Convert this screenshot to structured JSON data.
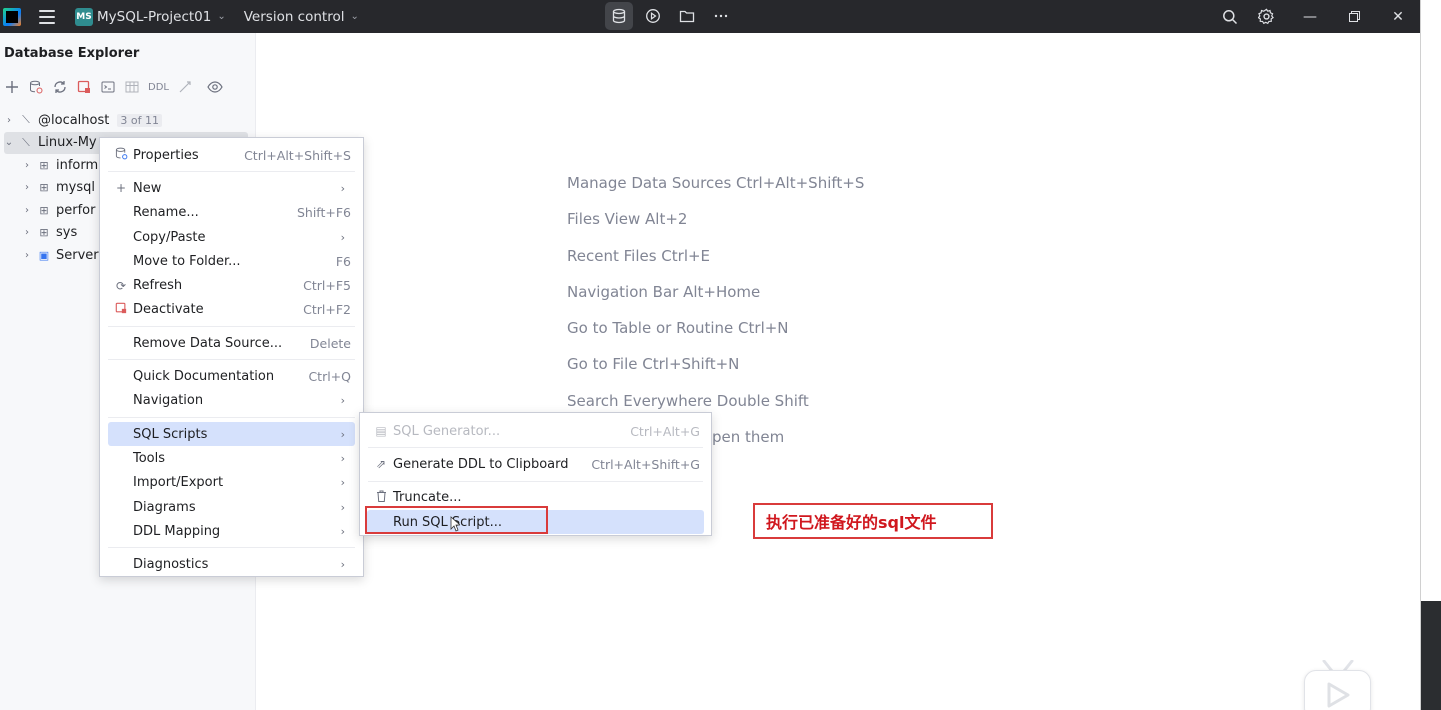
{
  "titlebar": {
    "project_badge": "MS",
    "project_name": "MySQL-Project01",
    "version_control": "Version control"
  },
  "panel": {
    "title": "Database Explorer",
    "toolbar_ddl": "DDL",
    "tree": [
      {
        "label": "@localhost",
        "count": "3 of 11",
        "expanded": false
      },
      {
        "label": "Linux-My",
        "expanded": true,
        "selected": true
      },
      {
        "label": "inform"
      },
      {
        "label": "mysql"
      },
      {
        "label": "perfor"
      },
      {
        "label": "sys"
      },
      {
        "label": "Server"
      }
    ]
  },
  "hints": [
    "Manage Data Sources Ctrl+Alt+Shift+S",
    "Files View Alt+2",
    "Recent Files Ctrl+E",
    "Navigation Bar Alt+Home",
    "Go to Table or Routine Ctrl+N",
    "Go to File Ctrl+Shift+N",
    "Search Everywhere Double Shift",
    "pen them"
  ],
  "context_menu": {
    "items": [
      {
        "label": "Properties",
        "shortcut": "Ctrl+Alt+Shift+S"
      },
      {
        "label": "New"
      },
      {
        "label": "Rename...",
        "shortcut": "Shift+F6"
      },
      {
        "label": "Copy/Paste"
      },
      {
        "label": "Move to Folder...",
        "shortcut": "F6"
      },
      {
        "label": "Refresh",
        "shortcut": "Ctrl+F5"
      },
      {
        "label": "Deactivate",
        "shortcut": "Ctrl+F2"
      },
      {
        "label": "Remove Data Source...",
        "shortcut": "Delete"
      },
      {
        "label": "Quick Documentation",
        "shortcut": "Ctrl+Q"
      },
      {
        "label": "Navigation"
      },
      {
        "label": "SQL Scripts"
      },
      {
        "label": "Tools"
      },
      {
        "label": "Import/Export"
      },
      {
        "label": "Diagrams"
      },
      {
        "label": "DDL Mapping"
      },
      {
        "label": "Diagnostics"
      }
    ]
  },
  "submenu": {
    "items": [
      {
        "label": "SQL Generator...",
        "shortcut": "Ctrl+Alt+G",
        "disabled": true
      },
      {
        "label": "Generate DDL to Clipboard",
        "shortcut": "Ctrl+Alt+Shift+G"
      },
      {
        "label": "Truncate..."
      },
      {
        "label": "Run SQL Script..."
      }
    ]
  },
  "annotation": "执行已准备好的sql文件"
}
